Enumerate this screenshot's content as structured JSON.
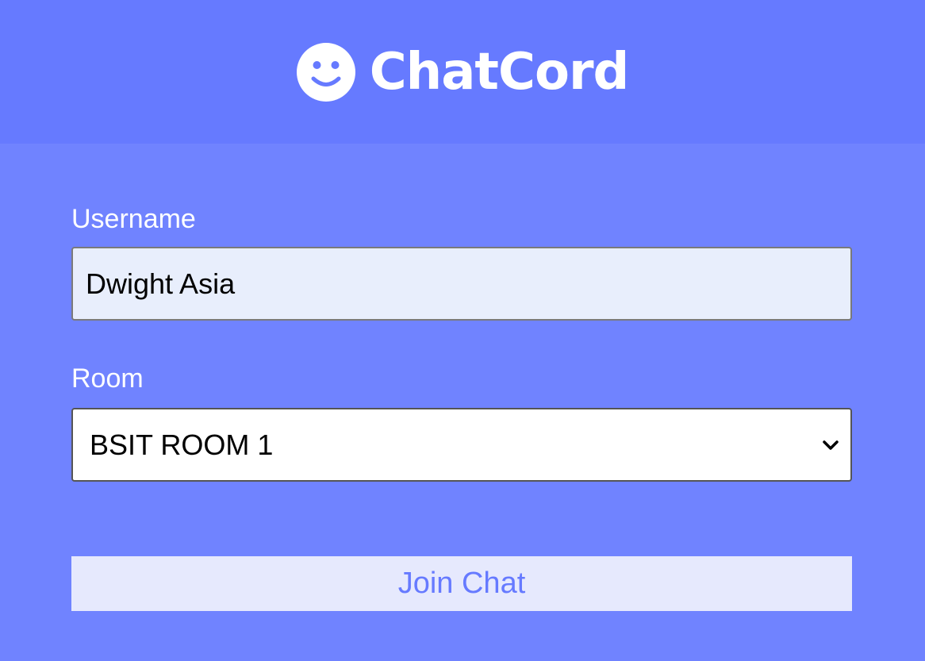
{
  "header": {
    "app_name": "ChatCord",
    "logo_icon": "smile-icon"
  },
  "form": {
    "username_label": "Username",
    "username_value": "Dwight Asia",
    "room_label": "Room",
    "room_selected": "BSIT ROOM 1",
    "room_dropdown_icon": "chevron-down-icon",
    "join_label": "Join Chat"
  },
  "colors": {
    "page_background": "#7083ff",
    "header_background": "#667aff",
    "button_background": "#e6e9fd",
    "button_text": "#667aff",
    "input_background": "#e8eefc"
  }
}
